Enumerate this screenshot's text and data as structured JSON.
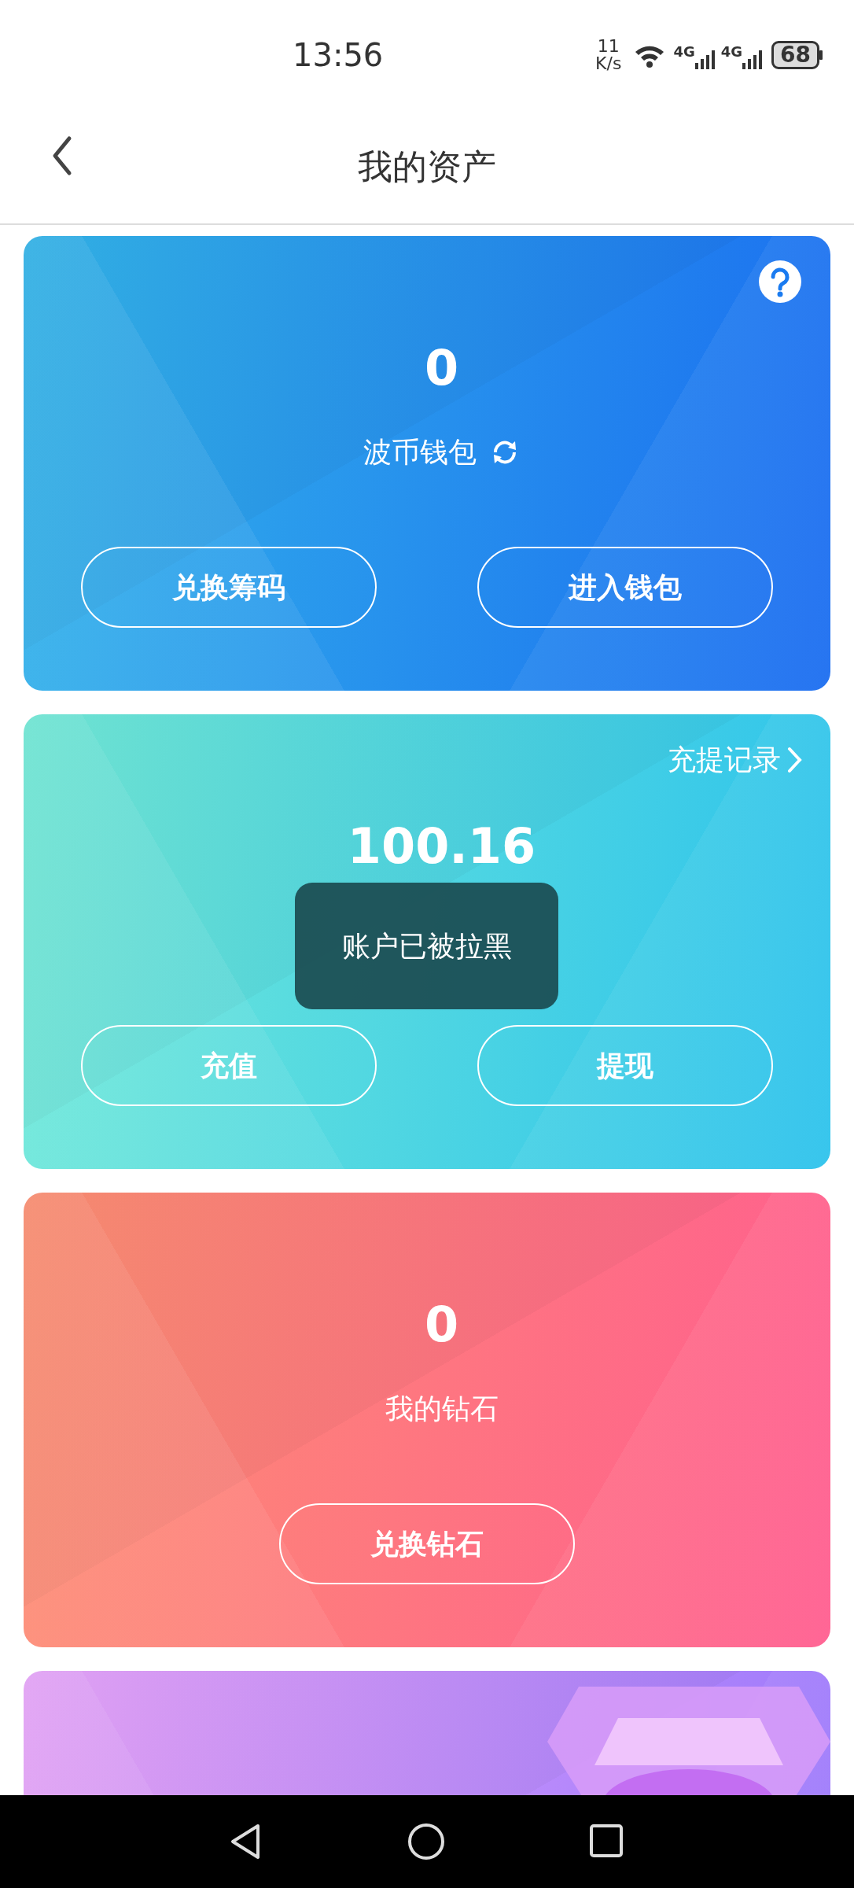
{
  "status_bar": {
    "time": "13:56",
    "net_speed_value": "11",
    "net_speed_unit": "K/s",
    "signals": [
      "4G",
      "4G"
    ],
    "battery": "68"
  },
  "header": {
    "title": "我的资产"
  },
  "cards": [
    {
      "kind": "wallet",
      "help": true,
      "amount": "0",
      "label": "波币钱包",
      "refresh": true,
      "buttons": [
        "兑换筹码",
        "进入钱包"
      ]
    },
    {
      "kind": "balance",
      "corner_link": "充提记录",
      "amount": "100.16",
      "buttons": [
        "充值",
        "提现"
      ]
    },
    {
      "kind": "diamond",
      "amount": "0",
      "label": "我的钻石",
      "buttons": [
        "兑换钻石"
      ]
    },
    {
      "kind": "gem"
    }
  ],
  "toast": {
    "text": "账户已被拉黑"
  }
}
